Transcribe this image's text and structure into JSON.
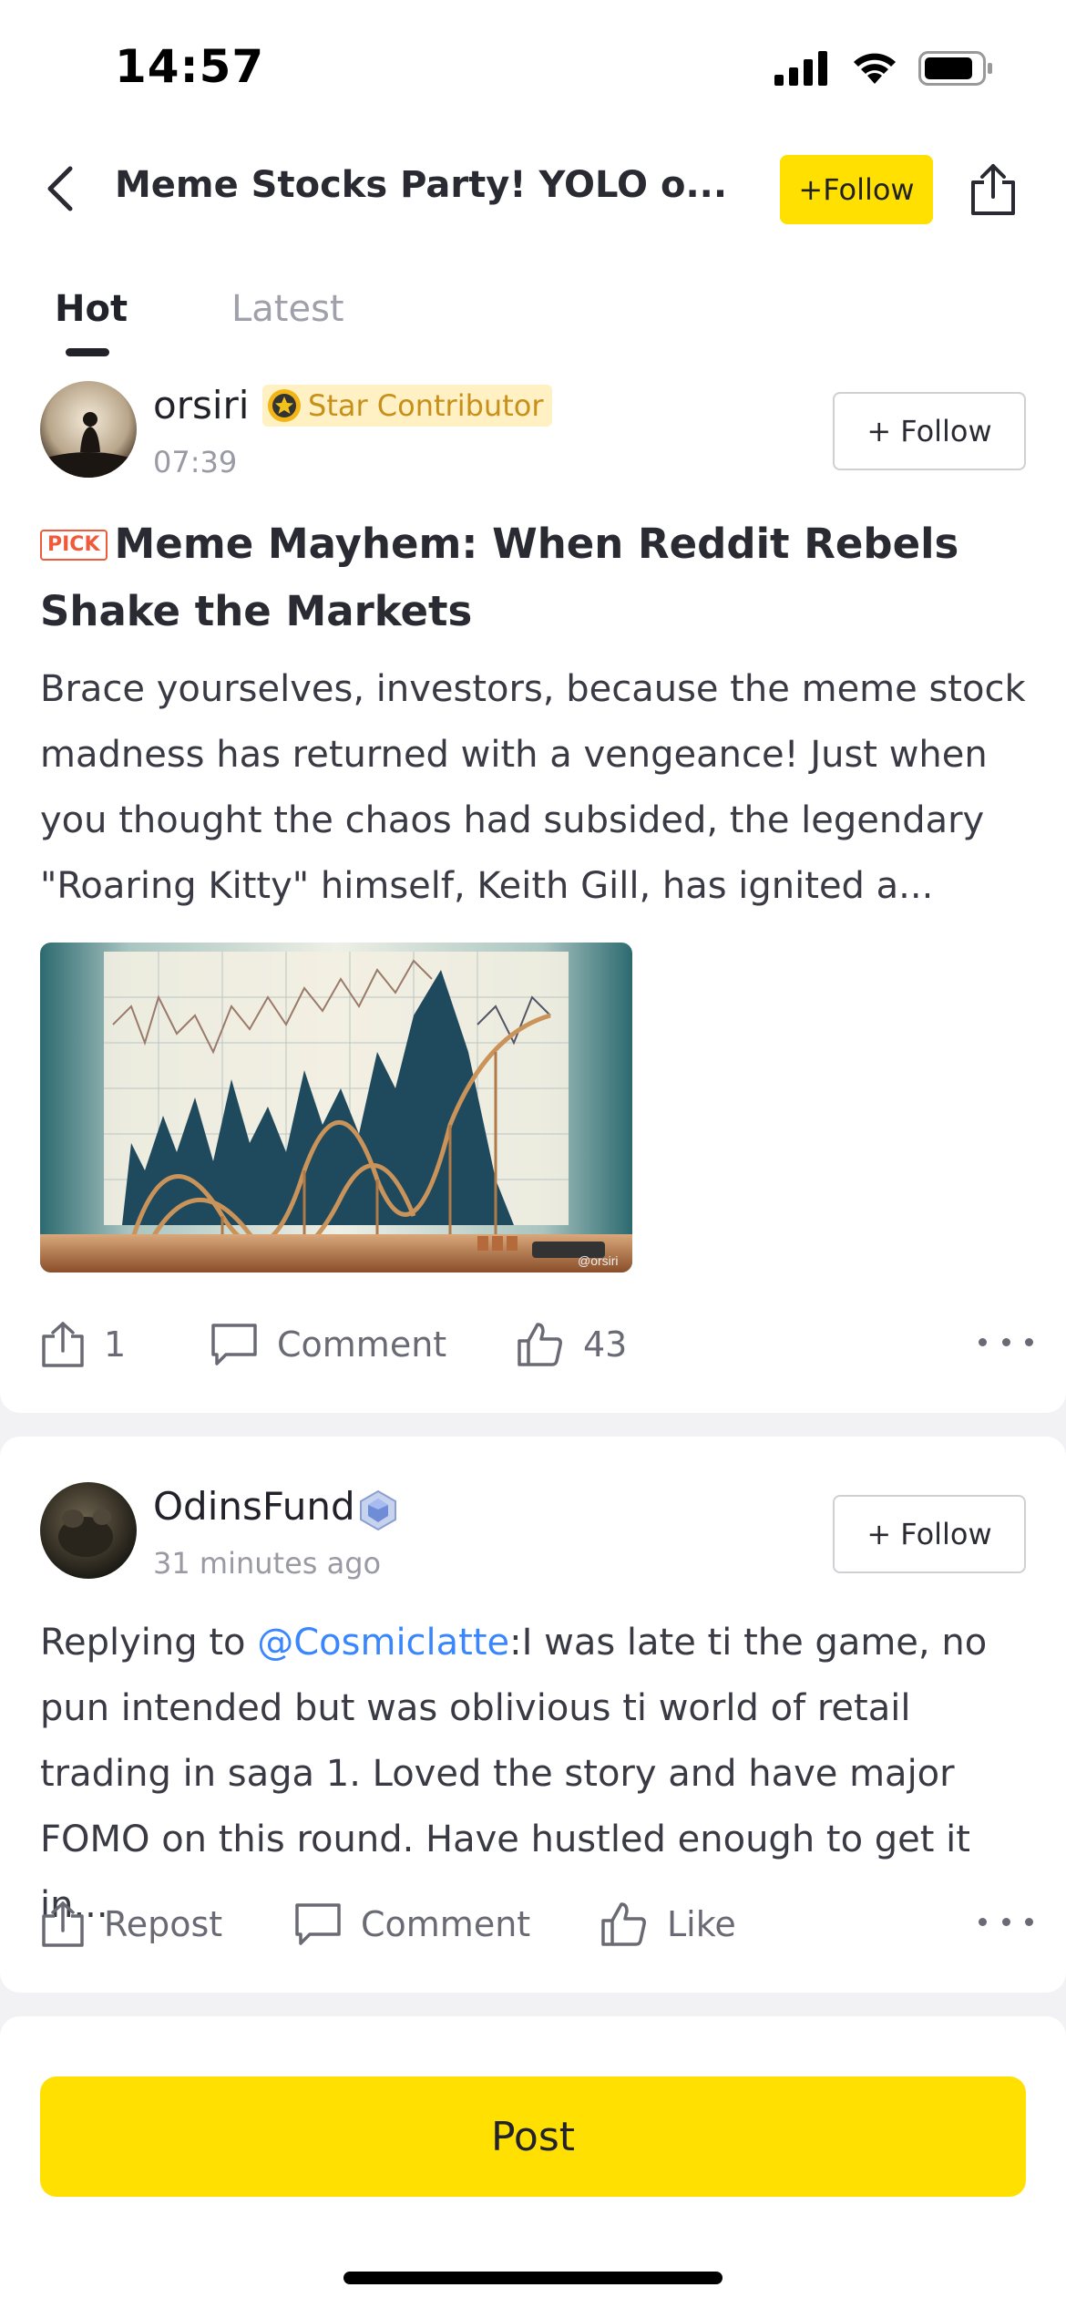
{
  "status_bar": {
    "time": "14:57"
  },
  "header": {
    "title": "Meme Stocks Party! YOLO o...",
    "follow_label": "+Follow"
  },
  "tabs": [
    {
      "label": "Hot",
      "active": true
    },
    {
      "label": "Latest",
      "active": false
    }
  ],
  "posts": [
    {
      "username": "orsiri",
      "badge": "Star Contributor",
      "time": "07:39",
      "follow_label": "+ Follow",
      "tag": "PICK",
      "title": "Meme Mayhem: When Reddit Rebels Shake the Markets",
      "body": "Brace yourselves, investors, because the meme stock madness has returned with a vengeance! Just when you thought the chaos had subsided, the legendary \"Roaring Kitty\" himself, Keith Gill, has ignited a...",
      "image_watermark": "@orsiri",
      "actions": {
        "repost": "1",
        "comment": "Comment",
        "like": "43"
      }
    },
    {
      "username": "OdinsFund",
      "time": "31 minutes ago",
      "follow_label": "+ Follow",
      "body_prefix": "Replying to ",
      "mention": "@Cosmiclatte",
      "body": ":I was late ti the game, no pun intended but was oblivious ti world of retail trading in saga 1. Loved the story and have major FOMO on this round. Have hustled enough to get it in...",
      "actions": {
        "repost": "Repost",
        "comment": "Comment",
        "like": "Like"
      }
    }
  ],
  "bottom": {
    "post_label": "Post"
  },
  "colors": {
    "accent": "#ffe000",
    "mention": "#3a86ff",
    "pick": "#f05a3a",
    "badge_bg": "#fff1c4"
  }
}
